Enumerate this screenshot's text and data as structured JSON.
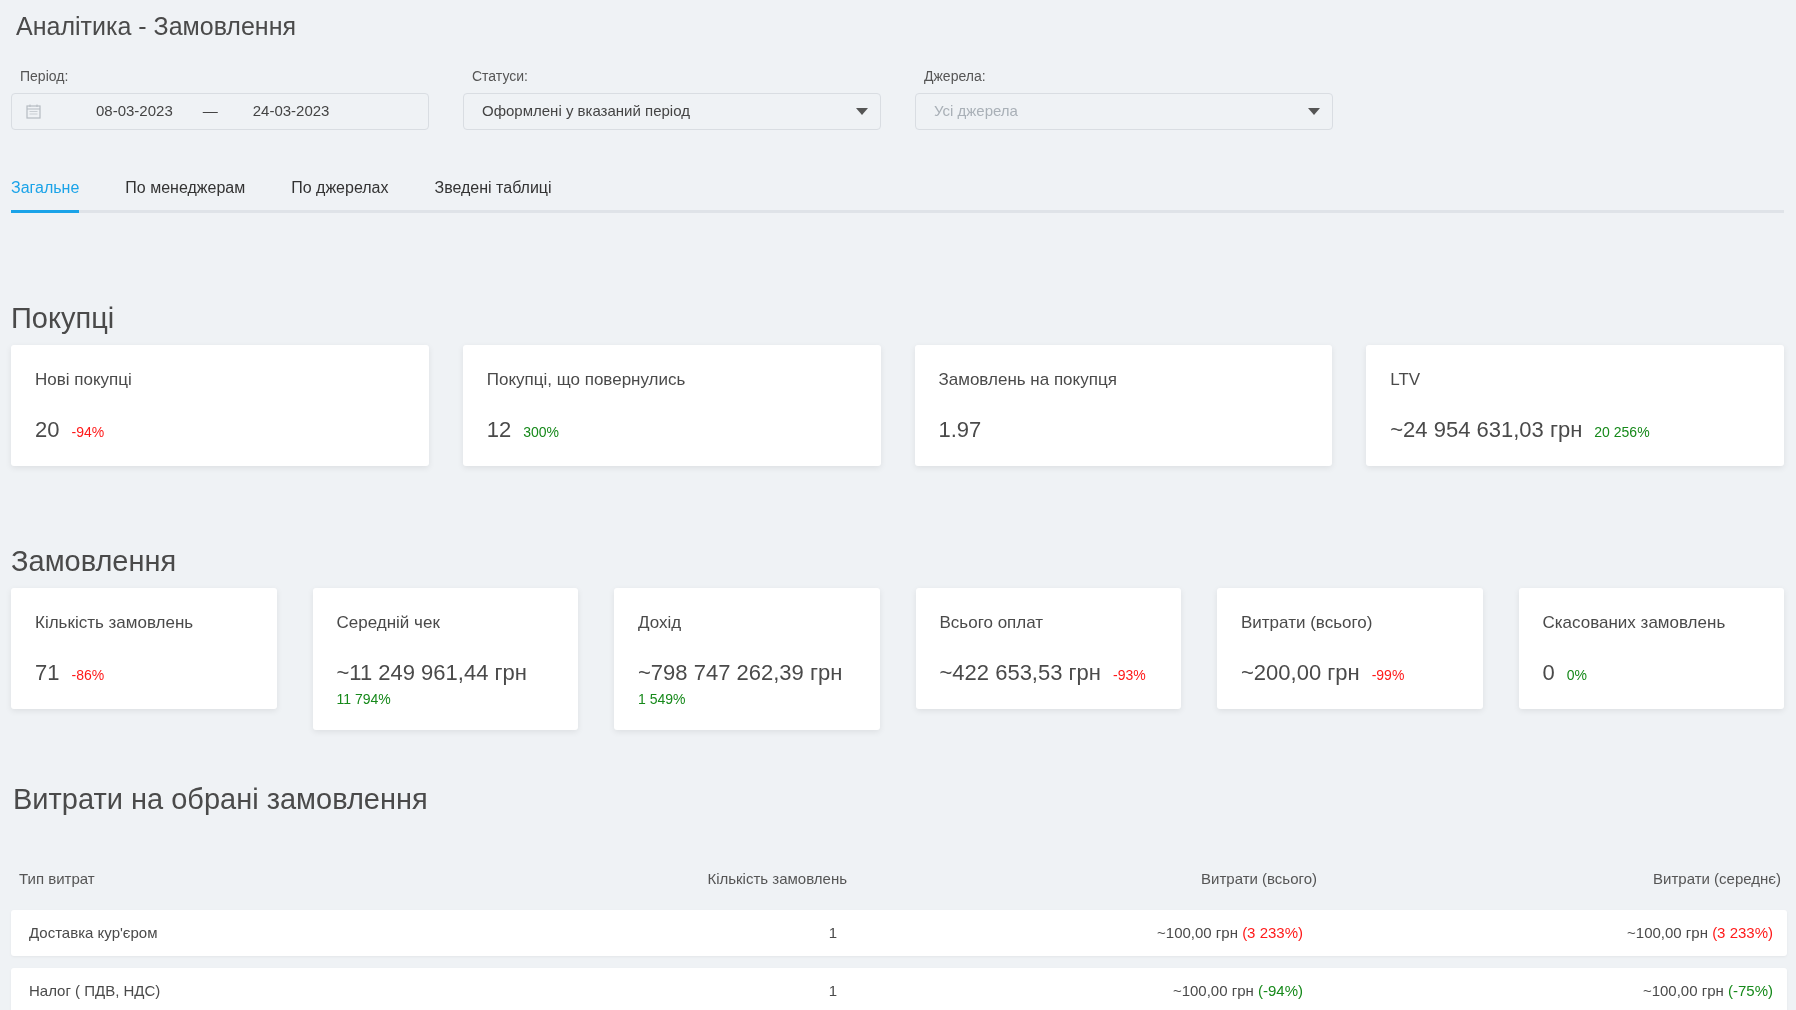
{
  "title": "Аналітика - Замовлення",
  "filters": {
    "period": {
      "label": "Період:",
      "from": "08-03-2023",
      "separator": "—",
      "to": "24-03-2023"
    },
    "statuses": {
      "label": "Статуси:",
      "value": "Оформлені у вказаний період"
    },
    "sources": {
      "label": "Джерела:",
      "placeholder": "Усі джерела"
    }
  },
  "tabs": [
    {
      "label": "Загальне",
      "selected": true
    },
    {
      "label": "По менеджерам",
      "selected": false
    },
    {
      "label": "По джерелах",
      "selected": false
    },
    {
      "label": "Зведені таблиці",
      "selected": false
    }
  ],
  "sections": [
    {
      "heading": "Покупці",
      "metrics": [
        {
          "label": "Нові покупці",
          "value": "20",
          "change": {
            "text": "-94%",
            "color": "#ff1a1a"
          }
        },
        {
          "label": "Покупці, що повернулись",
          "value": "12",
          "change": {
            "text": "300%",
            "color": "#16891a"
          }
        },
        {
          "label": "Замовлень на покупця",
          "value": "1.97"
        },
        {
          "label": "LTV",
          "value": "~24 954 631,03 грн",
          "change": {
            "text": "20 256%",
            "color": "#16891a"
          }
        }
      ]
    },
    {
      "heading": "Замовлення",
      "metrics": [
        {
          "label": "Кількість замовлень",
          "value": "71",
          "change": {
            "text": "-86%",
            "color": "#ff1a1a"
          }
        },
        {
          "label": "Середній чек",
          "value": "~11 249 961,44 грн",
          "change": {
            "text": "11 794%",
            "color": "#16891a"
          }
        },
        {
          "label": "Дохід",
          "value": "~798 747 262,39 грн",
          "change": {
            "text": "1 549%",
            "color": "#16891a"
          }
        },
        {
          "label": "Всього оплат",
          "value": "~422 653,53 грн",
          "change": {
            "text": "-93%",
            "color": "#ff1a1a"
          }
        },
        {
          "label": "Витрати (всього)",
          "value": "~200,00 грн",
          "change": {
            "text": "-99%",
            "color": "#ff1a1a"
          }
        },
        {
          "label": "Скасованих замовлень",
          "value": "0",
          "change": {
            "text": "0%",
            "color": "#16891a"
          }
        }
      ]
    }
  ],
  "expenses": {
    "heading": "Витрати на обрані замовлення",
    "columns": [
      "Тип витрат",
      "Кількість замовлень",
      "Витрати (всього)",
      "Витрати (середнє)"
    ],
    "rows": [
      {
        "type": "Доставка кур'єром",
        "count": "1",
        "total": {
          "amount": "~100,00 грн",
          "change": "(3 233%)",
          "color": "#ff1a1a"
        },
        "average": {
          "amount": "~100,00 грн",
          "change": "(3 233%)",
          "color": "#ff1a1a"
        }
      },
      {
        "type": "Налог ( ПДВ, НДС)",
        "count": "1",
        "total": {
          "amount": "~100,00 грн",
          "change": "(-94%)",
          "color": "#16891a"
        },
        "average": {
          "amount": "~100,00 грн",
          "change": "(-75%)",
          "color": "#16891a"
        }
      }
    ]
  }
}
